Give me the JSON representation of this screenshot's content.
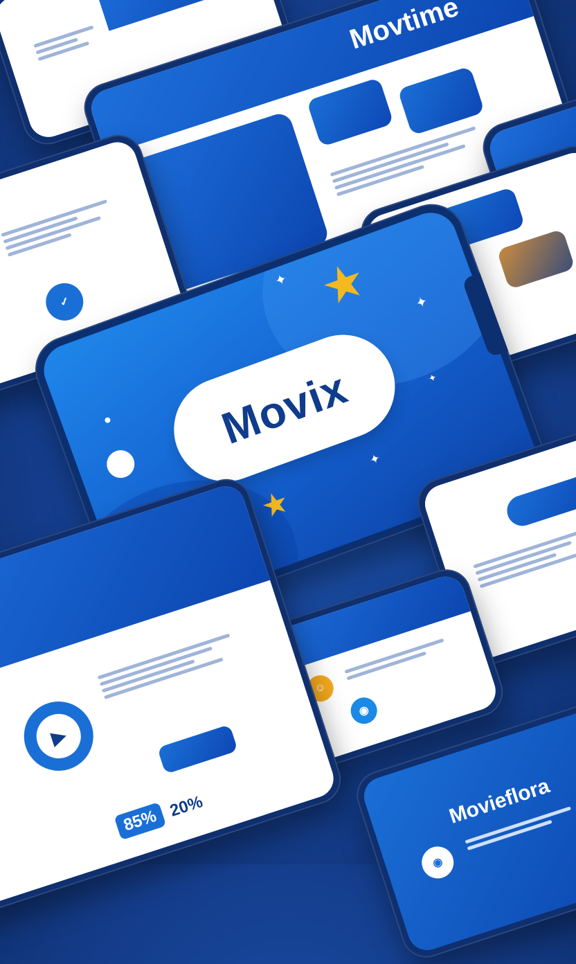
{
  "hero": {
    "logo": "Movix"
  },
  "top_phone": {
    "title": "Movtime"
  },
  "bottom_card": {
    "title": "Movieflora"
  },
  "left_card": {
    "percent_a": "85%",
    "percent_b": "20%"
  },
  "colors": {
    "primary": "#1460cf",
    "dark": "#0f3c8c",
    "accent": "#f4b91e",
    "bg": "#153f8f"
  },
  "icons": [
    "star-icon",
    "play-icon",
    "bird-icon",
    "camera-icon",
    "smile-icon"
  ]
}
